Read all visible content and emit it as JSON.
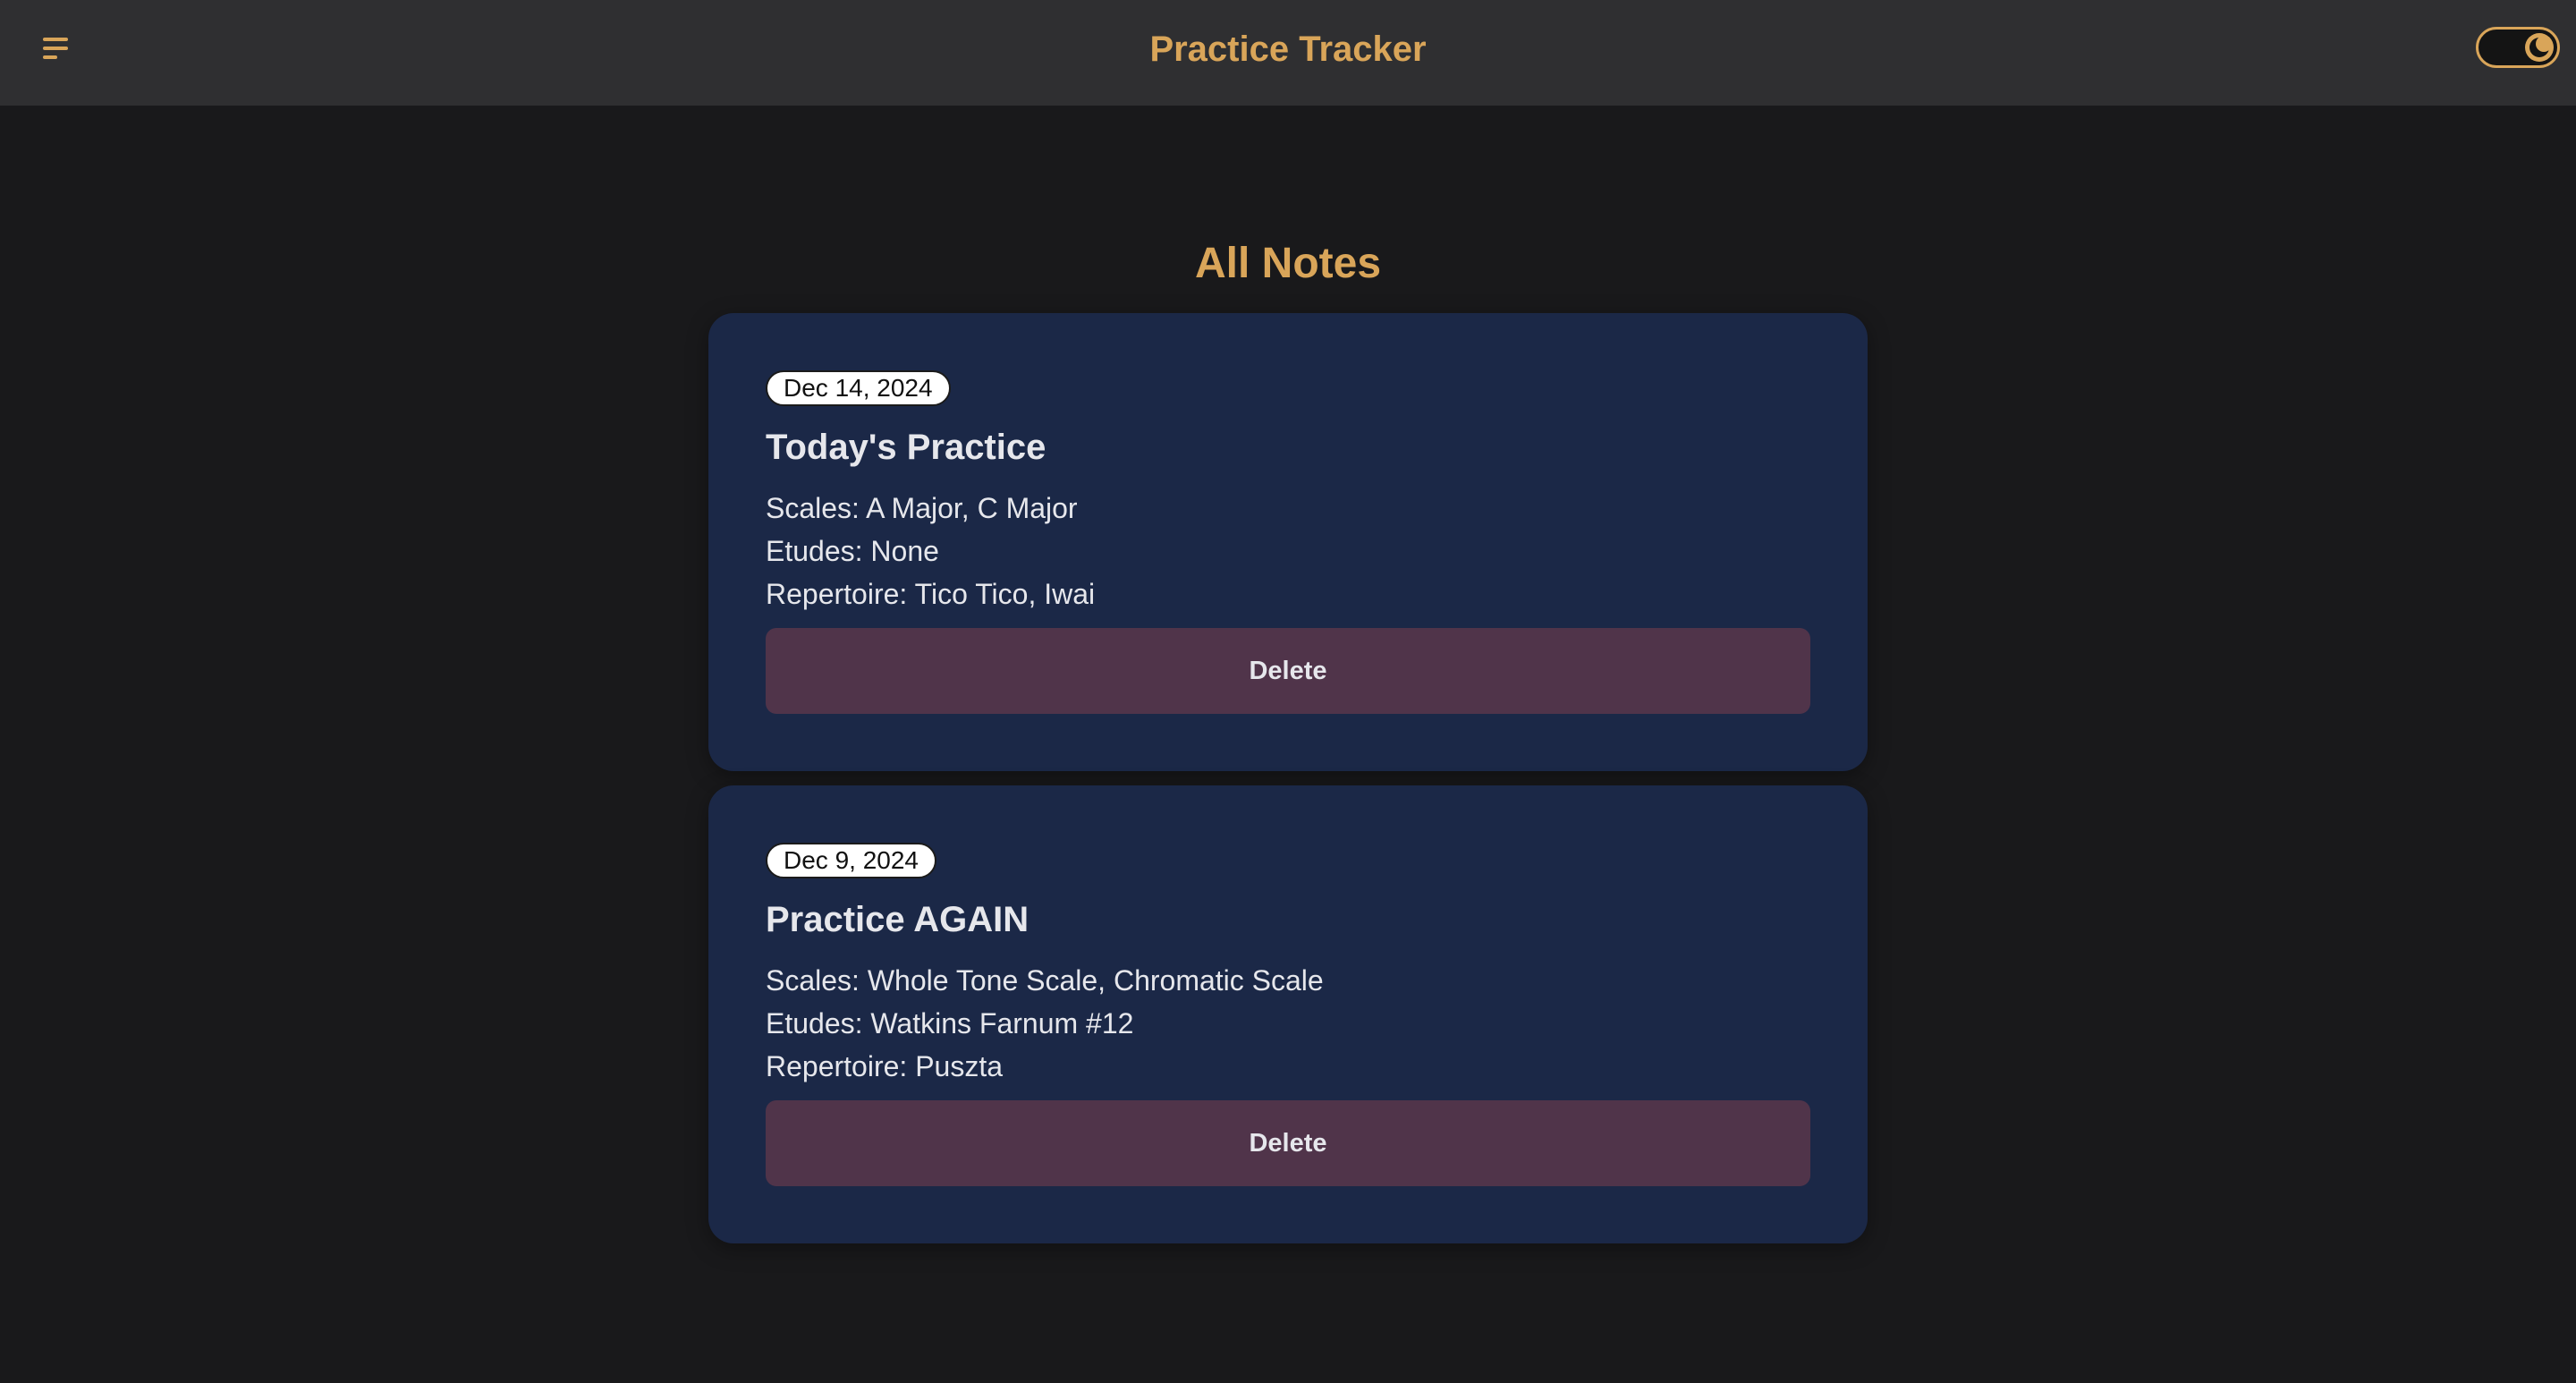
{
  "header": {
    "title": "Practice Tracker",
    "menu_icon": "hamburger-menu-icon",
    "theme_toggle_icon": "moon-icon"
  },
  "page": {
    "heading": "All Notes"
  },
  "notes": [
    {
      "date": "Dec 14, 2024",
      "title": "Today's Practice",
      "scales": "Scales: A Major, C Major",
      "etudes": "Etudes: None",
      "repertoire": "Repertoire: Tico Tico, Iwai",
      "delete_label": "Delete"
    },
    {
      "date": "Dec 9, 2024",
      "title": "Practice AGAIN",
      "scales": "Scales: Whole Tone Scale, Chromatic Scale",
      "etudes": "Etudes: Watkins Farnum #12",
      "repertoire": "Repertoire: Puszta",
      "delete_label": "Delete"
    }
  ],
  "colors": {
    "background": "#19191b",
    "header_background": "#2f2f31",
    "accent": "#d9a559",
    "card_background": "#1b2847",
    "delete_button": "#50344a",
    "text": "#e6e7ec"
  }
}
